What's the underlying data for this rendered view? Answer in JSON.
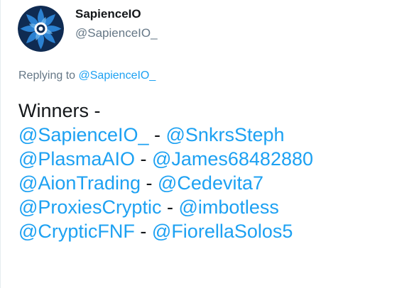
{
  "author": {
    "display_name": "SapienceIO",
    "screen_name": "@SapienceIO_",
    "avatar_icon": "star-flower-logo-icon"
  },
  "reply": {
    "prefix": "Replying to",
    "target": "@SapienceIO_"
  },
  "tweet": {
    "heading": "Winners -",
    "separator": " - ",
    "pairs": [
      [
        "@SapienceIO_",
        "@SnkrsSteph"
      ],
      [
        "@PlasmaAIO",
        "@James68482880"
      ],
      [
        "@AionTrading",
        "@Cedevita7"
      ],
      [
        "@ProxiesCryptic",
        "@imbotless"
      ],
      [
        "@CrypticFNF",
        "@FiorellaSolos5"
      ]
    ]
  },
  "colors": {
    "link": "#1da1f2",
    "text": "#14171a",
    "muted": "#657786",
    "avatar_bg": "#0f2b52",
    "avatar_accent": "#2e86d9"
  }
}
